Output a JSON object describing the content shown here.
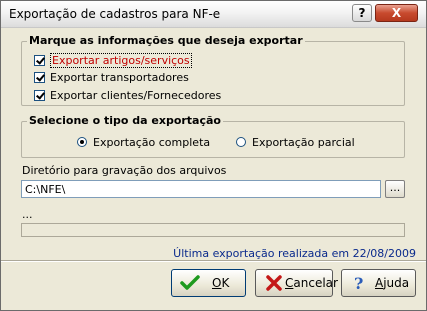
{
  "window": {
    "title": "Exportação de cadastros para NF-e",
    "help_label": "?",
    "close_label": "X"
  },
  "group_info": {
    "title": "Marque as informações que deseja exportar",
    "options": [
      {
        "label": "Exportar artigos/serviços",
        "checked": true
      },
      {
        "label": "Exportar transportadores",
        "checked": true
      },
      {
        "label": "Exportar clientes/Fornecedores",
        "checked": true
      }
    ]
  },
  "group_type": {
    "title": "Selecione o tipo da exportação",
    "options": [
      {
        "label": "Exportação completa",
        "selected": true
      },
      {
        "label": "Exportação parcial",
        "selected": false
      }
    ]
  },
  "directory": {
    "label": "Diretório para gravação dos arquivos",
    "value": "C:\\NFE\\",
    "browse_label": "..."
  },
  "status": {
    "text": "...",
    "progress": 0
  },
  "last_export": "Última exportação realizada em 22/08/2009",
  "buttons": {
    "ok": "OK",
    "cancel": "Cancelar",
    "help": "Ajuda"
  },
  "colors": {
    "accent": "#0a2a8c",
    "selected_option": "#c00000"
  }
}
